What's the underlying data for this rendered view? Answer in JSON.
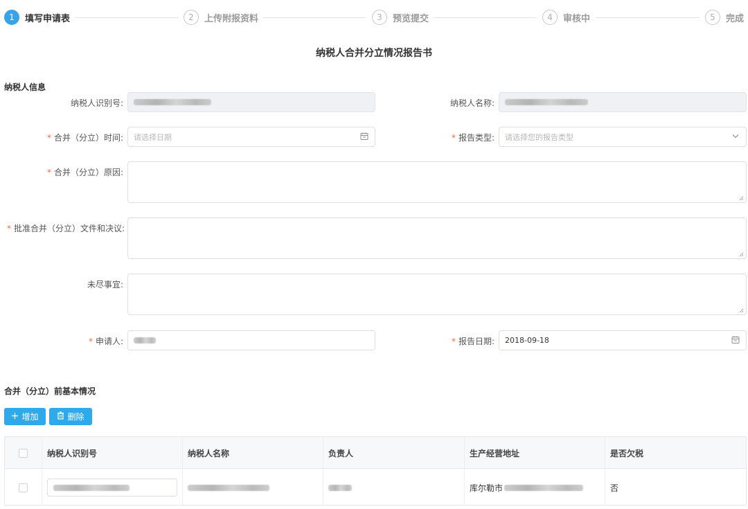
{
  "steps": [
    {
      "num": "1",
      "label": "填写申请表"
    },
    {
      "num": "2",
      "label": "上传附报资料"
    },
    {
      "num": "3",
      "label": "预览提交"
    },
    {
      "num": "4",
      "label": "审核中"
    },
    {
      "num": "5",
      "label": "完成"
    }
  ],
  "report_title": "纳税人合并分立情况报告书",
  "taxpayer_section": "纳税人信息",
  "form": {
    "tax_id_label": "纳税人识别号:",
    "tax_name_label": "纳税人名称:",
    "merge_time_label": "合并（分立）时间:",
    "merge_time_placeholder": "请选择日期",
    "report_type_label": "报告类型:",
    "report_type_placeholder": "请选择您的报告类型",
    "reason_label": "合并（分立）原因:",
    "approval_label": "批准合并（分立）文件和决议:",
    "other_label": "未尽事宜:",
    "applicant_label": "申请人:",
    "report_date_label": "报告日期:",
    "report_date_value": "2018-09-18"
  },
  "basic_section": "合并（分立）前基本情况",
  "buttons": {
    "add": "增加",
    "delete": "删除"
  },
  "table": {
    "headers": [
      "纳税人识别号",
      "纳税人名称",
      "负责人",
      "生产经营地址",
      "是否欠税"
    ],
    "row": {
      "address_prefix": "库尔勒市",
      "owes_tax": "否"
    }
  },
  "colors": {
    "accent": "#2fa9ea",
    "required": "#f56c3a",
    "disabled_bg": "#f0f1f4"
  },
  "icons": {
    "calendar": "calendar-icon",
    "dropdown": "chevron-down-icon",
    "add": "plus-icon",
    "delete": "trash-icon"
  }
}
